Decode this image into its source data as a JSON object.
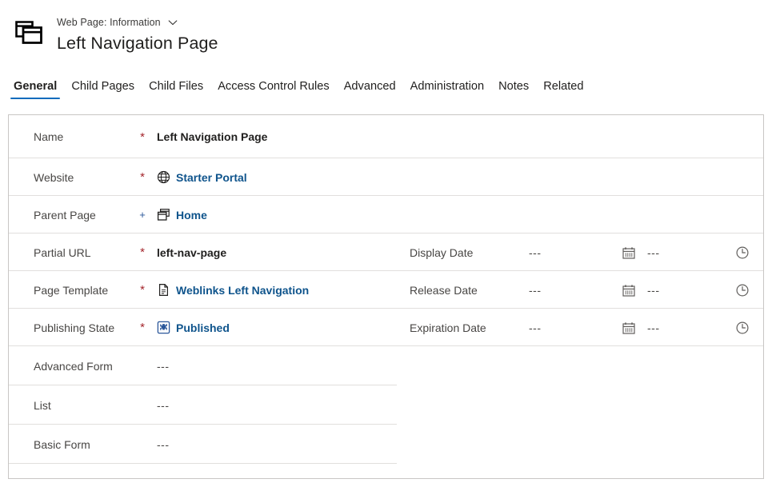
{
  "header": {
    "entity_icon": "web-page-icon",
    "breadcrumb": "Web Page: Information",
    "chevron_icon": "chevron-down-icon",
    "title": "Left Navigation Page"
  },
  "tabs": [
    {
      "label": "General",
      "selected": true
    },
    {
      "label": "Child Pages",
      "selected": false
    },
    {
      "label": "Child Files",
      "selected": false
    },
    {
      "label": "Access Control Rules",
      "selected": false
    },
    {
      "label": "Advanced",
      "selected": false
    },
    {
      "label": "Administration",
      "selected": false
    },
    {
      "label": "Notes",
      "selected": false
    },
    {
      "label": "Related",
      "selected": false
    }
  ],
  "colors": {
    "accent": "#0f6cbd",
    "link": "#0f548c",
    "required": "#a4262c",
    "business_recommended": "#2b579a",
    "border": "#c8c6c4",
    "divider": "#e1dfdd"
  },
  "form": {
    "left_rows": [
      {
        "label": "Name",
        "marker": "*",
        "marker_type": "required",
        "value": "Left Navigation Page",
        "value_style": "bold",
        "icon": null,
        "divider": "full"
      },
      {
        "label": "Website",
        "marker": "*",
        "marker_type": "required",
        "value": "Starter Portal",
        "value_style": "link",
        "icon": "globe-icon",
        "divider": "full"
      },
      {
        "label": "Parent Page",
        "marker": "+",
        "marker_type": "business-recommended",
        "value": "Home",
        "value_style": "link",
        "icon": "pages-stack-icon",
        "divider": "full"
      },
      {
        "label": "Partial URL",
        "marker": "*",
        "marker_type": "required",
        "value": "left-nav-page",
        "value_style": "bold",
        "icon": null,
        "divider": "full"
      },
      {
        "label": "Page Template",
        "marker": "*",
        "marker_type": "required",
        "value": "Weblinks Left Navigation",
        "value_style": "link",
        "icon": "document-icon",
        "divider": "full"
      },
      {
        "label": "Publishing State",
        "marker": "*",
        "marker_type": "required",
        "value": "Published",
        "value_style": "link",
        "icon": "publishing-state-icon",
        "divider": "full"
      },
      {
        "label": "Advanced Form",
        "marker": "",
        "marker_type": "none",
        "value": "---",
        "value_style": "muted",
        "icon": null,
        "divider": "half"
      },
      {
        "label": "List",
        "marker": "",
        "marker_type": "none",
        "value": "---",
        "value_style": "muted",
        "icon": null,
        "divider": "half"
      },
      {
        "label": "Basic Form",
        "marker": "",
        "marker_type": "none",
        "value": "---",
        "value_style": "muted",
        "icon": null,
        "divider": "half"
      }
    ],
    "right_rows": [
      {
        "label": "Display Date",
        "date_value": "---",
        "calendar_icon": "calendar-icon",
        "time_value": "---",
        "clock_icon": "clock-icon"
      },
      {
        "label": "Release Date",
        "date_value": "---",
        "calendar_icon": "calendar-icon",
        "time_value": "---",
        "clock_icon": "clock-icon"
      },
      {
        "label": "Expiration Date",
        "date_value": "---",
        "calendar_icon": "calendar-icon",
        "time_value": "---",
        "clock_icon": "clock-icon"
      }
    ]
  }
}
